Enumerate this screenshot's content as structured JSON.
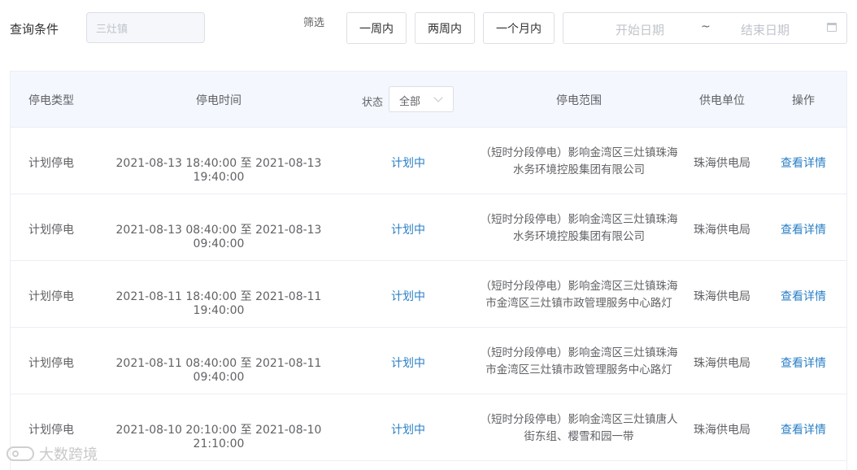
{
  "query": {
    "label": "查询条件",
    "input_value": "三灶镇"
  },
  "filter": {
    "label": "筛选",
    "buttons": [
      "一周内",
      "两周内",
      "一个月内"
    ]
  },
  "date_range": {
    "start_placeholder": "开始日期",
    "separator": "~",
    "end_placeholder": "结束日期",
    "icon": "calendar-icon"
  },
  "table": {
    "headers": {
      "type": "停电类型",
      "time": "停电时间",
      "status_label": "状态",
      "status_select": "全部",
      "scope": "停电范围",
      "unit": "供电单位",
      "op": "操作"
    },
    "rows": [
      {
        "type": "计划停电",
        "time": "2021-08-13 18:40:00 至 2021-08-13 19:40:00",
        "status": "计划中",
        "scope_line1": "（短时分段停电）影响金湾区三灶镇珠海",
        "scope_line2": "水务环境控股集团有限公司",
        "unit": "珠海供电局",
        "op": "查看详情"
      },
      {
        "type": "计划停电",
        "time": "2021-08-13 08:40:00 至 2021-08-13 09:40:00",
        "status": "计划中",
        "scope_line1": "（短时分段停电）影响金湾区三灶镇珠海",
        "scope_line2": "水务环境控股集团有限公司",
        "unit": "珠海供电局",
        "op": "查看详情"
      },
      {
        "type": "计划停电",
        "time": "2021-08-11 18:40:00 至 2021-08-11 19:40:00",
        "status": "计划中",
        "scope_line1": "（短时分段停电）影响金湾区三灶镇珠海",
        "scope_line2": "市金湾区三灶镇市政管理服务中心路灯",
        "unit": "珠海供电局",
        "op": "查看详情"
      },
      {
        "type": "计划停电",
        "time": "2021-08-11 08:40:00 至 2021-08-11 09:40:00",
        "status": "计划中",
        "scope_line1": "（短时分段停电）影响金湾区三灶镇珠海",
        "scope_line2": "市金湾区三灶镇市政管理服务中心路灯",
        "unit": "珠海供电局",
        "op": "查看详情"
      },
      {
        "type": "计划停电",
        "time": "2021-08-10 20:10:00 至 2021-08-10 21:10:00",
        "status": "计划中",
        "scope_line1": "（短时分段停电）影响金湾区三灶镇唐人",
        "scope_line2": "街东组、樱雪和园一带",
        "unit": "珠海供电局",
        "op": "查看详情"
      }
    ]
  },
  "watermark": {
    "text": "大数跨境"
  },
  "colors": {
    "link": "#2a7fc6",
    "header_bg": "#f4f7fd",
    "border": "#ebeef5"
  }
}
